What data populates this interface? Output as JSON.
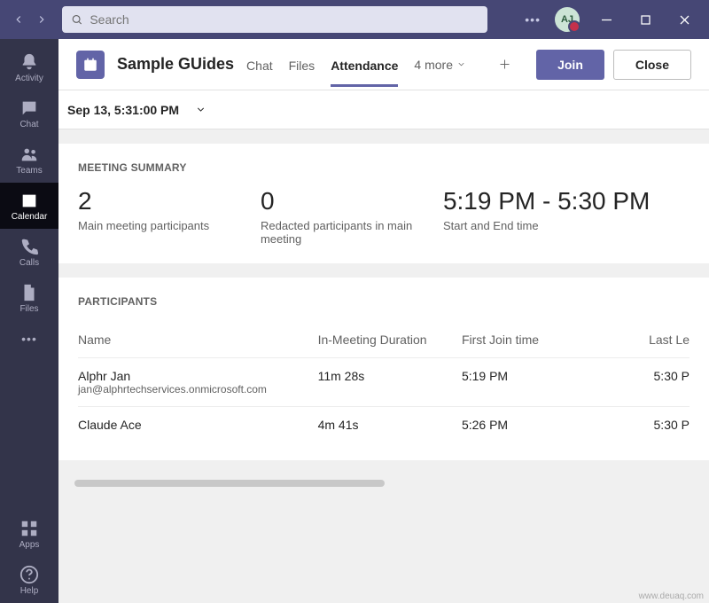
{
  "search": {
    "placeholder": "Search"
  },
  "avatar": {
    "initials": "AJ"
  },
  "rail": {
    "items": [
      {
        "label": "Activity"
      },
      {
        "label": "Chat"
      },
      {
        "label": "Teams"
      },
      {
        "label": "Calendar"
      },
      {
        "label": "Calls"
      },
      {
        "label": "Files"
      }
    ],
    "apps_label": "Apps",
    "help_label": "Help"
  },
  "header": {
    "title": "Sample GUides",
    "tabs": {
      "chat": "Chat",
      "files": "Files",
      "attendance": "Attendance"
    },
    "more": "4 more",
    "join": "Join",
    "close": "Close"
  },
  "timestamp_selector": "Sep 13, 5:31:00 PM",
  "summary": {
    "label": "MEETING SUMMARY",
    "cells": [
      {
        "big": "2",
        "small": "Main meeting participants"
      },
      {
        "big": "0",
        "small": "Redacted participants in main meeting"
      },
      {
        "big": "5:19 PM - 5:30 PM",
        "small": "Start and End time"
      }
    ]
  },
  "participants": {
    "label": "PARTICIPANTS",
    "columns": {
      "name": "Name",
      "duration": "In-Meeting Duration",
      "first": "First Join time",
      "last": "Last Le"
    },
    "rows": [
      {
        "name": "Alphr Jan",
        "email": "jan@alphrtechservices.onmicrosoft.com",
        "duration": "11m 28s",
        "first": "5:19 PM",
        "last": "5:30 P"
      },
      {
        "name": "Claude Ace",
        "email": "",
        "duration": "4m 41s",
        "first": "5:26 PM",
        "last": "5:30 P"
      }
    ]
  },
  "watermark": "www.deuaq.com"
}
